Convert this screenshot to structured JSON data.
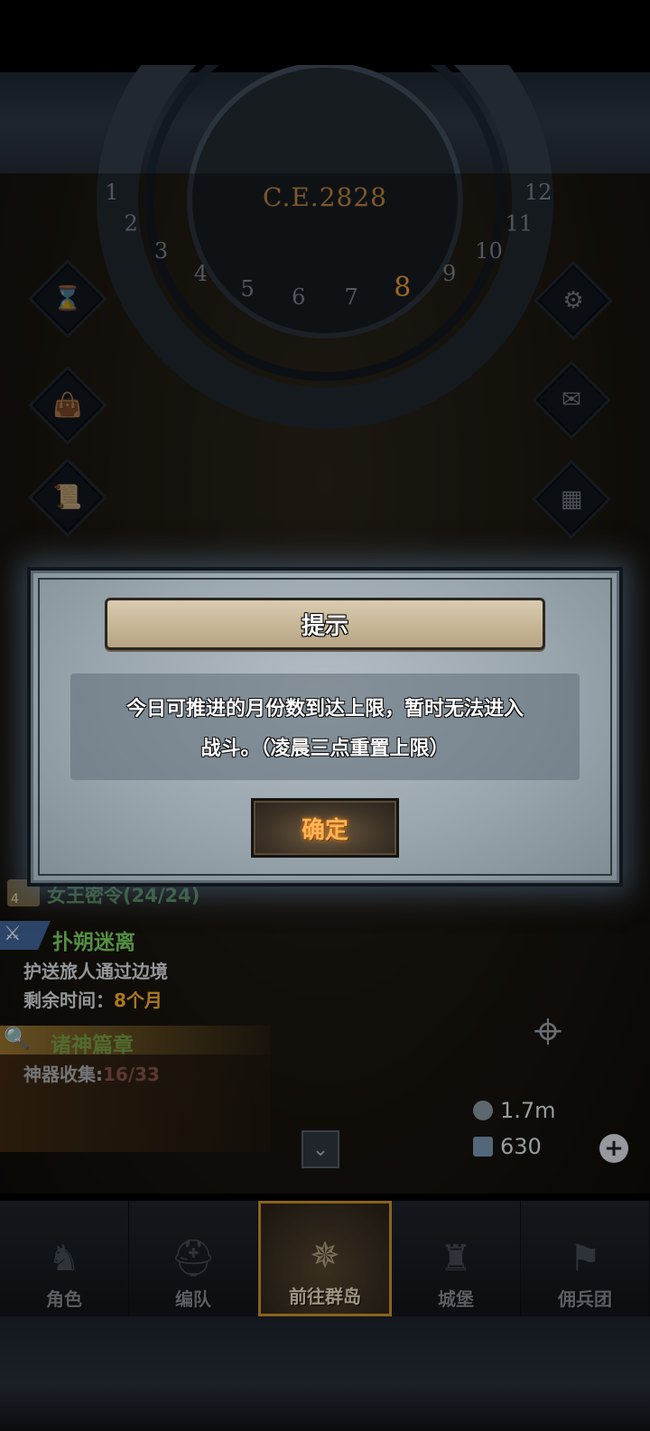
{
  "hud": {
    "year": "C.E.2828",
    "months": [
      "1",
      "2",
      "3",
      "4",
      "5",
      "6",
      "7",
      "8",
      "9",
      "10",
      "11",
      "12"
    ],
    "current_month": "8"
  },
  "quests": {
    "queen_order": "女王密令(24/24)",
    "quest_badge": "4",
    "main_quest_title": "扑朔迷离",
    "main_quest_desc": "护送旅人通过边境",
    "time_label": "剩余时间：",
    "time_value": "8个月",
    "gods_chapter_title": "诸神篇章",
    "artifact_label": "神器收集:",
    "artifact_value": "16/33"
  },
  "resources": {
    "coins": "1.7m",
    "crystals": "630"
  },
  "dialog": {
    "title": "提示",
    "message_line1": "今日可推进的月份数到达上限，暂时无法进入",
    "message_line2": "战斗。（凌晨三点重置上限）",
    "confirm_label": "确定"
  },
  "nav": {
    "items": [
      {
        "label": "角色",
        "icon": "knight-icon"
      },
      {
        "label": "编队",
        "icon": "helmet-icon"
      },
      {
        "label": "前往群岛",
        "icon": "compass-icon"
      },
      {
        "label": "城堡",
        "icon": "castle-icon"
      },
      {
        "label": "佣兵团",
        "icon": "banner-icon"
      }
    ]
  },
  "colors": {
    "accent_gold": "#b98524",
    "confirm_text": "#ffb455",
    "quest_green": "#6fbf5a",
    "time_orange": "#e6a030"
  }
}
